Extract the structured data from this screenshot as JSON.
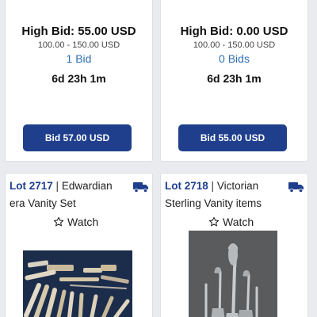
{
  "lots": [
    {
      "high_bid": "High Bid: 55.00 USD",
      "estimate": "100.00 - 150.00 USD",
      "bid_count": "1 Bid",
      "time_left": "6d 23h 1m",
      "bid_button": "Bid 57.00 USD"
    },
    {
      "high_bid": "High Bid: 0.00 USD",
      "estimate": "100.00 - 150.00 USD",
      "bid_count": "0 Bids",
      "time_left": "6d 23h 1m",
      "bid_button": "Bid 55.00 USD"
    },
    {
      "lot_number": "Lot 2717",
      "title": "Edwardian era Vanity Set",
      "watch_label": "Watch",
      "shipping_icon": "truck-icon",
      "image": "vanity-set-photo"
    },
    {
      "lot_number": "Lot 2718",
      "title": "Victorian Sterling Vanity items",
      "watch_label": "Watch",
      "shipping_icon": "truck-icon",
      "image": "sterling-vanity-photo"
    }
  ],
  "colors": {
    "accent": "#1f3f8d",
    "link": "#2f6fb5",
    "background": "#e9ebee",
    "card": "#ffffff"
  }
}
